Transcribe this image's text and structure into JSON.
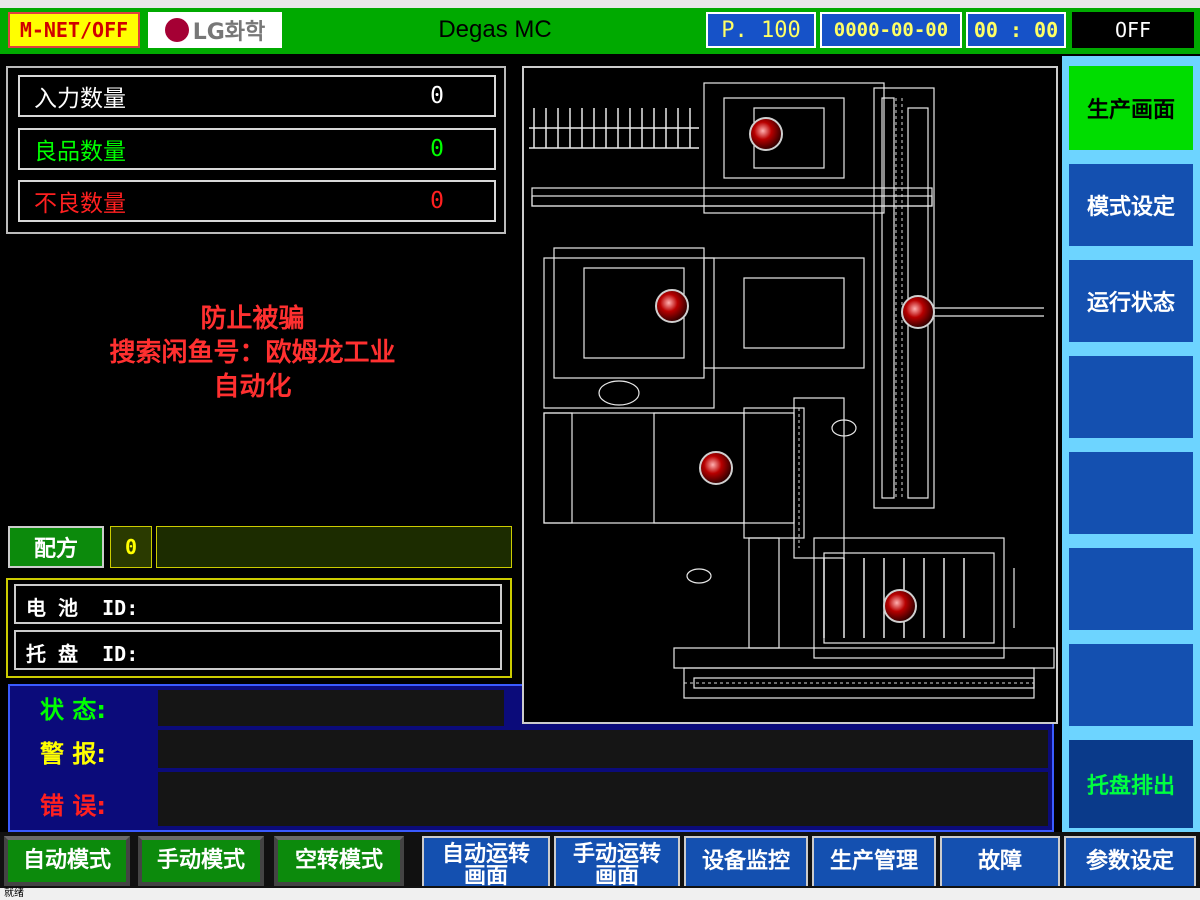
{
  "header": {
    "mnet": "M-NET/OFF",
    "brand": "LG화학",
    "title": "Degas MC",
    "program": "P. 100",
    "date": "0000-00-00",
    "time": "00 : 00",
    "status": "OFF"
  },
  "counts": {
    "input_label": "入力数量",
    "input_value": "0",
    "good_label": "良品数量",
    "good_value": "0",
    "bad_label": "不良数量",
    "bad_value": "0"
  },
  "overlay": {
    "line1": "防止被骗",
    "line2": "搜索闲鱼号：欧姆龙工业",
    "line3": "自动化"
  },
  "recipe": {
    "label": "配方",
    "value": "0"
  },
  "ids": {
    "battery": "电 池  ID:",
    "tray": "托 盘  ID:"
  },
  "messages": {
    "status": "状 态:",
    "alarm": "警 报:",
    "error": "错 误:"
  },
  "side_menu": {
    "production": "生产画面",
    "mode_setting": "模式设定",
    "run_status": "运行状态",
    "tray_eject": "托盘排出"
  },
  "bottom_menu": {
    "auto_mode": "自动模式",
    "manual_mode": "手动模式",
    "dry_run_mode": "空转模式",
    "auto_run_screen": "自动运转\n画面",
    "manual_run_screen": "手动运转\n画面",
    "equipment_monitor": "设备监控",
    "production_mgmt": "生产管理",
    "fault": "故障",
    "parameter_setting": "参数设定"
  },
  "footer": {
    "text": "就绪"
  },
  "colors": {
    "header_green": "#00aa00",
    "panel_blue": "#1450b0",
    "alarm_red": "#ff2020",
    "ok_green": "#00ff00"
  }
}
